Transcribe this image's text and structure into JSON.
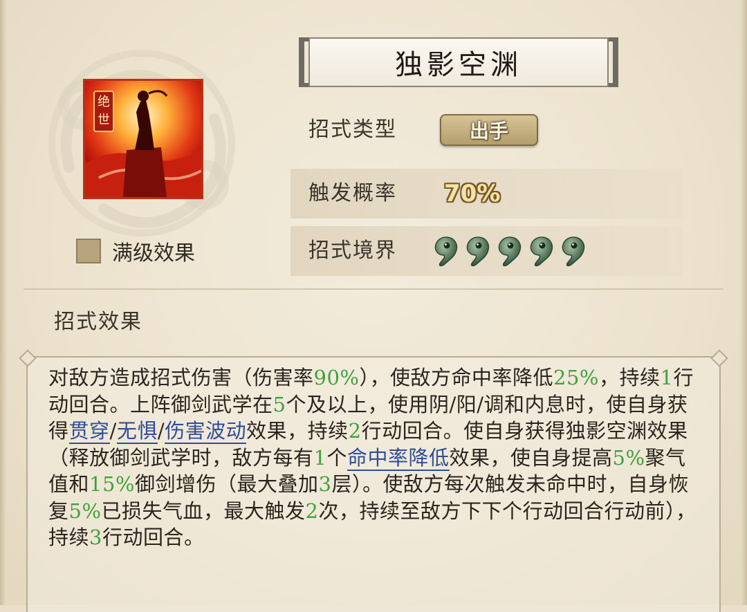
{
  "skill": {
    "name": "独影空渊",
    "badge": "绝世"
  },
  "max_level": {
    "label": "满级效果",
    "checked": false
  },
  "attributes": {
    "type_label": "招式类型",
    "type_value": "出手",
    "rate_label": "触发概率",
    "rate_value": "70%",
    "realm_label": "招式境界",
    "realm_level": 5
  },
  "effect": {
    "title": "招式效果",
    "t1": "对敌方造成招式伤害（伤害率",
    "n1": "90%",
    "t2": "），使敌方命中率降低",
    "n2": "25%",
    "t3": "，持续",
    "n3": "1",
    "t4": "行动回合。上阵御剑武学在",
    "n4": "5",
    "t5": "个及以上，使用阴/阳/调和内息时，使自身获得",
    "k1": "贯穿",
    "s1": "/",
    "k2": "无惧",
    "s2": "/",
    "k3": "伤害波动",
    "t6": "效果，持续",
    "n5": "2",
    "t7": "行动回合。使自身获得独影空渊效果（释放御剑武学时，敌方每有",
    "n6": "1",
    "t8": "个",
    "k4": "命中率降低",
    "t9": "效果，使自身提高",
    "n7": "5%",
    "t10": "聚气值和",
    "n8": "15%",
    "t11": "御剑增伤（最大叠加",
    "n9": "3",
    "t12": "层）。使敌方每次触发未命中时，自身恢复",
    "n10": "5%",
    "t13": "已损失气血，最大触发",
    "n11": "2",
    "t14": "次，持续至敌方下下个行动回合行动前），持续",
    "n12": "3",
    "t15": "行动回合。"
  },
  "colors": {
    "highlight_number": "#3fa23c",
    "keyword_link": "#2f4e9a",
    "icon_frame": "#c41d10",
    "jade": "#4a6a52"
  },
  "icons": [
    "cloud-ornament",
    "skill-icon",
    "jade-realm-icon"
  ]
}
